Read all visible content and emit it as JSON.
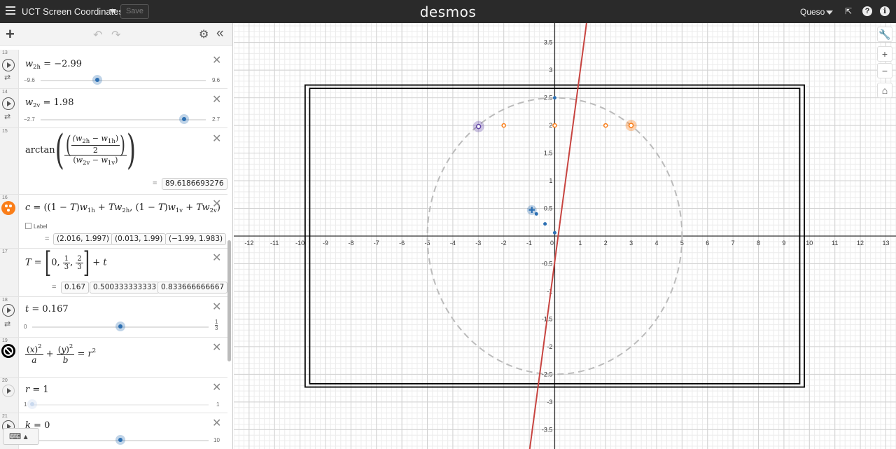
{
  "header": {
    "title": "UCT Screen Coordinates",
    "save_label": "Save",
    "logo": "desmos",
    "user": "Queso"
  },
  "expressions": {
    "e13": {
      "num": "13",
      "var": "w",
      "sub": "2h",
      "value": "−2.99",
      "min": "−9.6",
      "max": "9.6",
      "level": 0.344
    },
    "e14": {
      "num": "14",
      "var": "w",
      "sub": "2v",
      "value": "1.98",
      "min": "−2.7",
      "max": "2.7",
      "level": 0.867
    },
    "e15": {
      "num": "15",
      "fn": "arctan",
      "result": "89.6186693276"
    },
    "e16": {
      "num": "16",
      "label_text": "Label",
      "results": [
        "(2.016, 1.997)",
        "(0.013, 1.99)",
        "(−1.99, 1.983)"
      ]
    },
    "e17": {
      "num": "17",
      "results": [
        "0.167",
        "0.500333333333",
        "0.833666666667"
      ]
    },
    "e18": {
      "num": "18",
      "var": "t",
      "value": "0.167",
      "min": "0",
      "max_n": "1",
      "max_d": "3",
      "level": 0.5
    },
    "e19": {
      "num": "19"
    },
    "e20": {
      "num": "20",
      "var": "r",
      "value": "1",
      "min": "1",
      "max": "1",
      "level": 0.0
    },
    "e21": {
      "num": "21",
      "var": "k",
      "value": "0",
      "max": "10",
      "level": 0.5
    }
  },
  "icons": {
    "menu": "hamburger-icon",
    "wrench": "wrench-icon",
    "zoom_in": "plus-icon",
    "zoom_out": "minus-icon",
    "home": "home-icon"
  },
  "graph": {
    "x_ticks": [
      "-12",
      "-11",
      "-10",
      "-9",
      "-8",
      "-7",
      "-6",
      "-5",
      "-4",
      "-3",
      "-2",
      "-1",
      "0",
      "1",
      "2",
      "3",
      "4",
      "5",
      "6",
      "7",
      "8",
      "9",
      "10",
      "11",
      "12",
      "13"
    ],
    "y_ticks": [
      "3.5",
      "3",
      "2.5",
      "2",
      "1.5",
      "1",
      "0.5",
      "-0.5",
      "-1",
      "-1.5",
      "-2",
      "-2.5",
      "-3",
      "-3.5"
    ],
    "x_range": [
      -12.6,
      13.4
    ],
    "y_range": [
      -3.85,
      3.85
    ],
    "colors": {
      "red": "#c74440",
      "blue": "#2d70b3",
      "orange": "#fa7e19",
      "purple": "#6042a6",
      "circle": "#bbbbbb"
    }
  }
}
